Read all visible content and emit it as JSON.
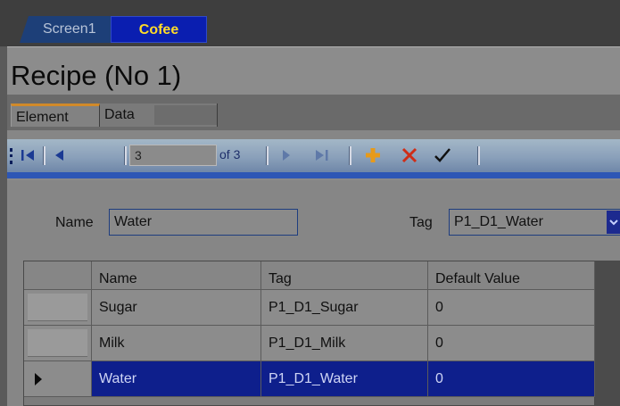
{
  "screen_tabs": [
    {
      "label": "Screen1",
      "active": false
    },
    {
      "label": "Cofee",
      "active": true
    }
  ],
  "header": {
    "title": "Recipe (No 1)"
  },
  "tabs": [
    {
      "label": "Element",
      "active": true
    },
    {
      "label": "Data",
      "active": false
    }
  ],
  "toolbar": {
    "first_icon": "first-record-icon",
    "prev_icon": "previous-record-icon",
    "position_value": "3",
    "of_text": "of 3",
    "next_icon": "next-record-icon",
    "last_icon": "last-record-icon",
    "add_icon": "add-icon",
    "delete_icon": "delete-icon",
    "confirm_icon": "confirm-icon"
  },
  "fields": {
    "name_label": "Name",
    "name_value": "Water",
    "tag_label": "Tag",
    "tag_value": "P1_D1_Water"
  },
  "grid": {
    "columns": [
      "Name",
      "Tag",
      "Default Value"
    ],
    "rows": [
      {
        "name": "Sugar",
        "tag": "P1_D1_Sugar",
        "default": "0",
        "selected": false
      },
      {
        "name": "Milk",
        "tag": "P1_D1_Milk",
        "default": "0",
        "selected": false
      },
      {
        "name": "Water",
        "tag": "P1_D1_Water",
        "default": "0",
        "selected": true
      }
    ]
  },
  "colors": {
    "active_tab_bg": "#0a1eb0",
    "active_tab_text": "#ffdc28",
    "selection_bg": "#0e1f8c",
    "add_icon": "#e79a1a",
    "delete_icon": "#cf2d17"
  }
}
